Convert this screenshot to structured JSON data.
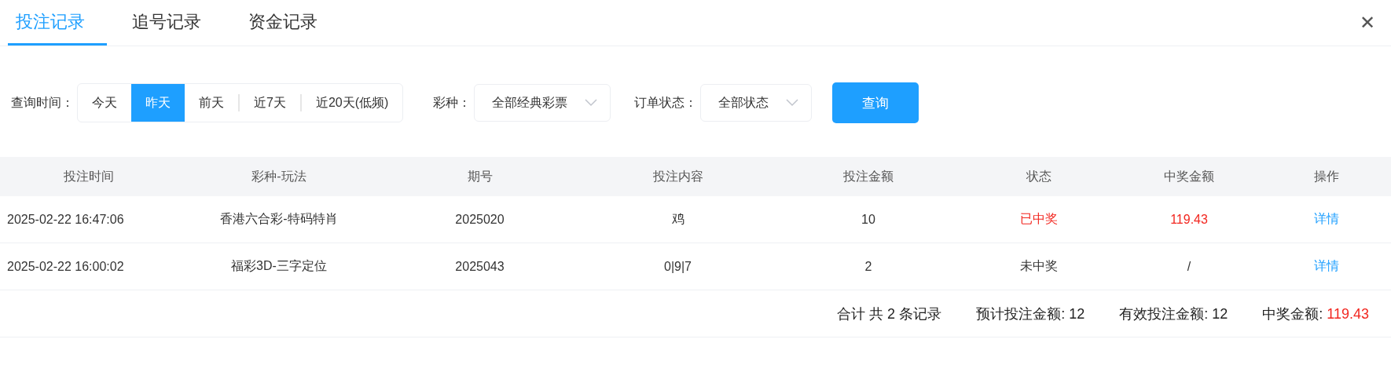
{
  "tabs": [
    {
      "label": "投注记录",
      "selected": true
    },
    {
      "label": "追号记录",
      "selected": false
    },
    {
      "label": "资金记录",
      "selected": false
    }
  ],
  "close": "✕",
  "filters": {
    "time_label": "查询时间：",
    "time_options": [
      {
        "label": "今天",
        "selected": false
      },
      {
        "label": "昨天",
        "selected": true
      },
      {
        "label": "前天",
        "selected": false
      },
      {
        "label": "近7天",
        "selected": false
      },
      {
        "label": "近20天(低频)",
        "selected": false
      }
    ],
    "lottery_label": "彩种：",
    "lottery_value": "全部经典彩票",
    "status_label": "订单状态：",
    "status_value": "全部状态",
    "query_button": "查询"
  },
  "table": {
    "columns": [
      "投注时间",
      "彩种-玩法",
      "期号",
      "投注内容",
      "投注金额",
      "状态",
      "中奖金额",
      "操作"
    ],
    "rows": [
      {
        "time": "2025-02-22 16:47:06",
        "game": "香港六合彩-特码特肖",
        "issue": "2025020",
        "content": "鸡",
        "amount": "10",
        "status": "已中奖",
        "won": true,
        "prize": "119.43",
        "action": "详情"
      },
      {
        "time": "2025-02-22 16:00:02",
        "game": "福彩3D-三字定位",
        "issue": "2025043",
        "content": "0|9|7",
        "amount": "2",
        "status": "未中奖",
        "won": false,
        "prize": "/",
        "action": "详情"
      }
    ]
  },
  "summary": [
    {
      "label": "合计 共 2 条记录"
    },
    {
      "label": "预计投注金额:",
      "value": "12"
    },
    {
      "label": "有效投注金额:",
      "value": "12"
    },
    {
      "label": "中奖金额:",
      "value": "119.43",
      "highlight": true
    }
  ]
}
